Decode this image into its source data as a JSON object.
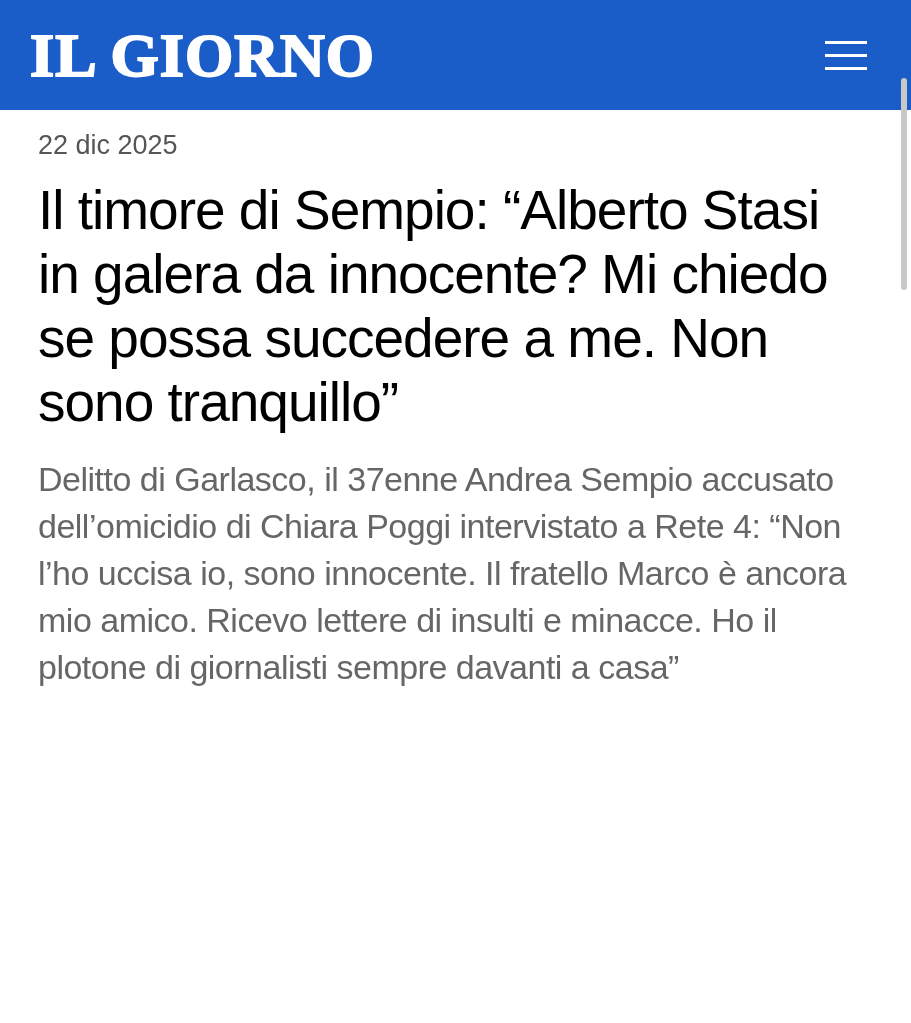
{
  "header": {
    "logo": "IL GIORNO"
  },
  "article": {
    "date": "22 dic 2025",
    "headline": "Il timore di Sempio: “Alberto Stasi in galera da innocente? Mi chiedo se possa succedere a me. Non sono tranquillo”",
    "summary": "Delitto di Garlasco, il 37enne Andrea Sempio accusato dell’omicidio di Chiara Poggi intervistato a Rete 4: “Non l’ho uccisa io, sono innocente. Il fratello Marco è ancora mio amico. Ricevo lettere di insulti e minacce. Ho il plotone di giornalisti sempre davanti a casa”"
  }
}
